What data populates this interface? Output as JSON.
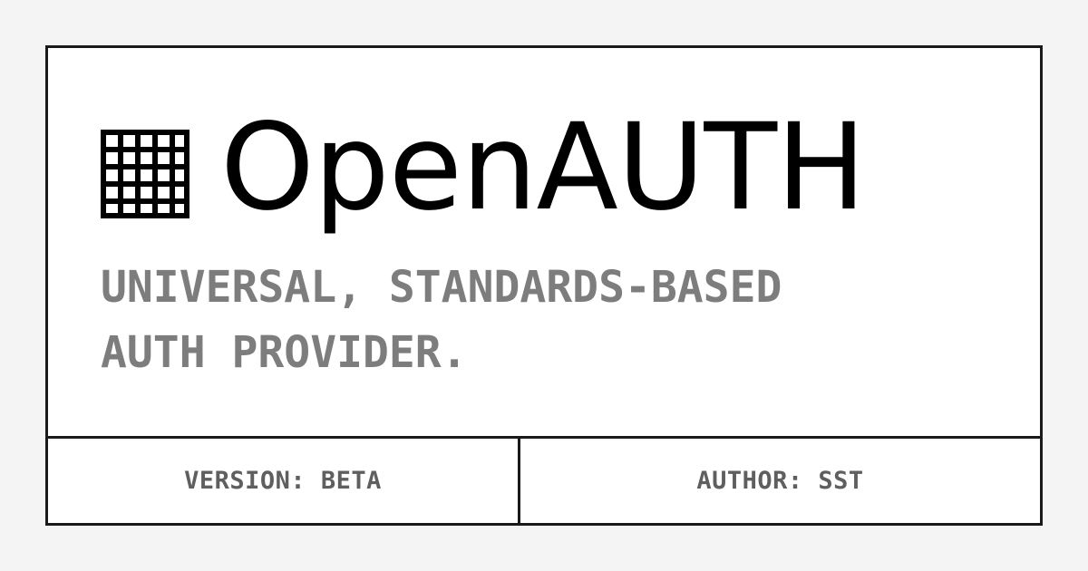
{
  "brand": {
    "name": "OpenAUTH",
    "logo_icon": "grid-logo-icon"
  },
  "tagline": {
    "line1": "UNIVERSAL, STANDARDS-BASED",
    "line2": "AUTH PROVIDER."
  },
  "footer": {
    "version": "VERSION: BETA",
    "author": "AUTHOR: SST"
  },
  "colors": {
    "background": "#f4f4f4",
    "card": "#ffffff",
    "border": "#1a1a1a",
    "brand_text": "#000000",
    "tagline_text": "#7d7d7d",
    "footer_text": "#5f5f5f"
  }
}
